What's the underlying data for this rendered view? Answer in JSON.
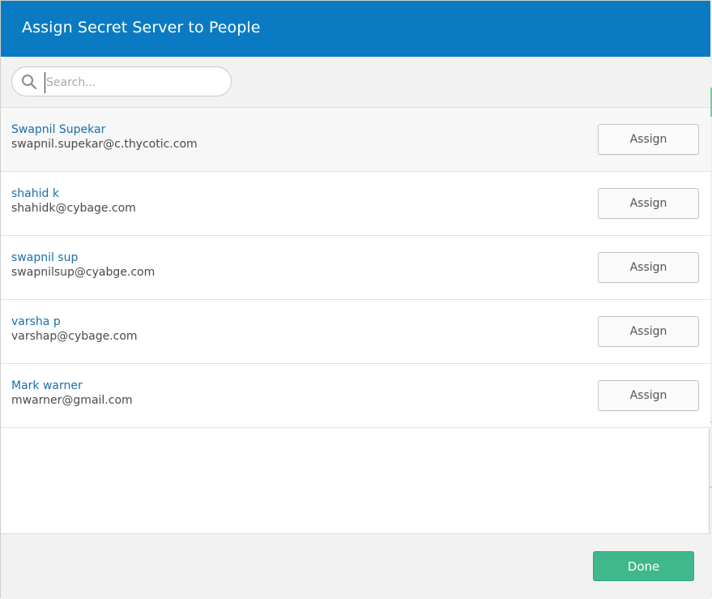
{
  "dialog": {
    "title": "Assign Secret Server to People"
  },
  "search": {
    "placeholder": "Search...",
    "value": ""
  },
  "people": [
    {
      "name": "Swapnil Supekar",
      "email": "swapnil.supekar@c.thycotic.com",
      "action": "Assign"
    },
    {
      "name": "shahid k",
      "email": "shahidk@cybage.com",
      "action": "Assign"
    },
    {
      "name": "swapnil sup",
      "email": "swapnilsup@cyabge.com",
      "action": "Assign"
    },
    {
      "name": "varsha p",
      "email": "varshap@cybage.com",
      "action": "Assign"
    },
    {
      "name": "Mark warner",
      "email": "mwarner@gmail.com",
      "action": "Assign"
    }
  ],
  "footer": {
    "done_label": "Done"
  },
  "colors": {
    "header": "#0a7bc3",
    "link": "#1a6fa8",
    "done": "#3fb88c"
  }
}
